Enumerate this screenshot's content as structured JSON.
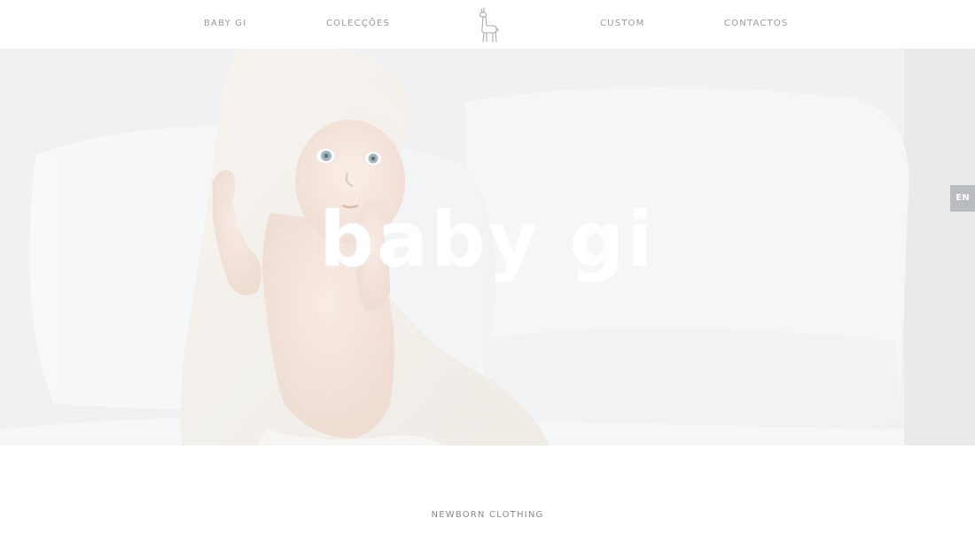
{
  "nav": {
    "items": [
      {
        "label": "BABY GI"
      },
      {
        "label": "COLECÇÕES"
      },
      {
        "label": "CUSTOM"
      },
      {
        "label": "CONTACTOS"
      }
    ],
    "logo_icon": "llama-icon"
  },
  "hero": {
    "title": "baby gi",
    "image": "baby-in-hooded-towel-photo"
  },
  "language": {
    "label": "EN"
  },
  "section": {
    "label": "NEWBORN CLOTHING"
  },
  "colors": {
    "nav_text": "#9a9a9a",
    "hero_overlay": "#eef0f2",
    "lang_bg": "#b9bcbe",
    "title": "#ffffff"
  }
}
